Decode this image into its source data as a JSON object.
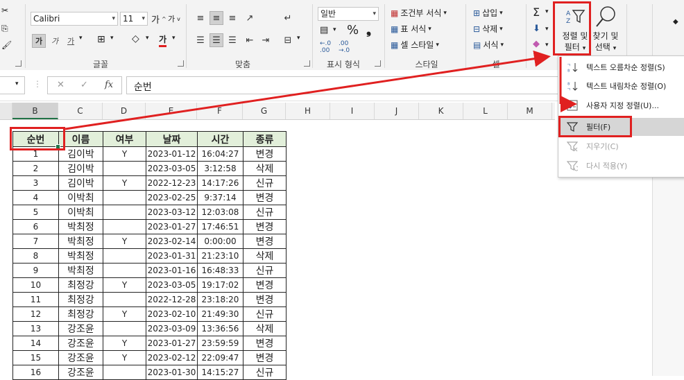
{
  "ribbon": {
    "font": {
      "name": "Calibri",
      "size": "11",
      "grow": "가",
      "shrink": "가",
      "bold": "가",
      "italic": "가",
      "underline": "가",
      "group_label": "글꼴"
    },
    "align": {
      "group_label": "맞춤"
    },
    "number": {
      "format": "일반",
      "percent": "%",
      "comma": "9",
      "inc": "←.0 .00",
      "dec": ".00 →.0",
      "group_label": "표시 형식"
    },
    "styles": {
      "conditional": "조건부 서식",
      "table": "표 서식",
      "cell": "셀 스타일",
      "group_label": "스타일"
    },
    "cells": {
      "insert": "삽입",
      "delete": "삭제",
      "format": "서식",
      "group_label": "셀"
    },
    "editing": {
      "sort_filter_line1": "정렬 및",
      "sort_filter_line2": "필터",
      "find_line1": "찾기 및",
      "find_line2": "선택"
    }
  },
  "formula_bar": {
    "name_box": "",
    "content": "순번",
    "fx": "fx"
  },
  "columns": [
    "B",
    "C",
    "D",
    "E",
    "F",
    "G",
    "H",
    "I",
    "J",
    "K",
    "L",
    "M"
  ],
  "table": {
    "headers": [
      "순번",
      "이름",
      "여부",
      "날짜",
      "시간",
      "종류"
    ],
    "rows": [
      [
        "1",
        "김이박",
        "Y",
        "2023-01-12",
        "16:04:27",
        "변경"
      ],
      [
        "2",
        "김이박",
        "",
        "2023-03-05",
        "3:12:58",
        "삭제"
      ],
      [
        "3",
        "김이박",
        "Y",
        "2022-12-23",
        "14:17:26",
        "신규"
      ],
      [
        "4",
        "이박최",
        "",
        "2023-02-25",
        "9:37:14",
        "변경"
      ],
      [
        "5",
        "이박최",
        "",
        "2023-03-12",
        "12:03:08",
        "신규"
      ],
      [
        "6",
        "박최정",
        "",
        "2023-01-27",
        "17:46:51",
        "변경"
      ],
      [
        "7",
        "박최정",
        "Y",
        "2023-02-14",
        "0:00:00",
        "변경"
      ],
      [
        "8",
        "박최정",
        "",
        "2023-01-31",
        "21:23:10",
        "삭제"
      ],
      [
        "9",
        "박최정",
        "",
        "2023-01-16",
        "16:48:33",
        "신규"
      ],
      [
        "10",
        "최정강",
        "Y",
        "2023-03-05",
        "19:17:02",
        "변경"
      ],
      [
        "11",
        "최정강",
        "",
        "2022-12-28",
        "23:18:20",
        "변경"
      ],
      [
        "12",
        "최정강",
        "Y",
        "2023-02-10",
        "21:49:30",
        "신규"
      ],
      [
        "13",
        "강조윤",
        "",
        "2023-03-09",
        "13:36:56",
        "삭제"
      ],
      [
        "14",
        "강조윤",
        "Y",
        "2023-01-27",
        "23:59:59",
        "변경"
      ],
      [
        "15",
        "강조윤",
        "Y",
        "2023-02-12",
        "22:09:47",
        "변경"
      ],
      [
        "16",
        "강조윤",
        "",
        "2023-01-30",
        "14:15:27",
        "신규"
      ]
    ]
  },
  "menu": {
    "items": [
      {
        "label": "텍스트 오름차순 정렬(S)",
        "icon": "sort-asc-icon",
        "enabled": true
      },
      {
        "label": "텍스트 내림차순 정렬(O)",
        "icon": "sort-desc-icon",
        "enabled": true
      },
      {
        "label": "사용자 지정 정렬(U)...",
        "icon": "custom-sort-icon",
        "enabled": true
      },
      {
        "label": "필터(F)",
        "icon": "filter-icon",
        "enabled": true
      },
      {
        "label": "지우기(C)",
        "icon": "clear-filter-icon",
        "enabled": false
      },
      {
        "label": "다시 적용(Y)",
        "icon": "reapply-icon",
        "enabled": false
      }
    ]
  },
  "colors": {
    "annotation_red": "#e02020",
    "header_fill": "#e2efda",
    "selected_accent": "#217346"
  }
}
